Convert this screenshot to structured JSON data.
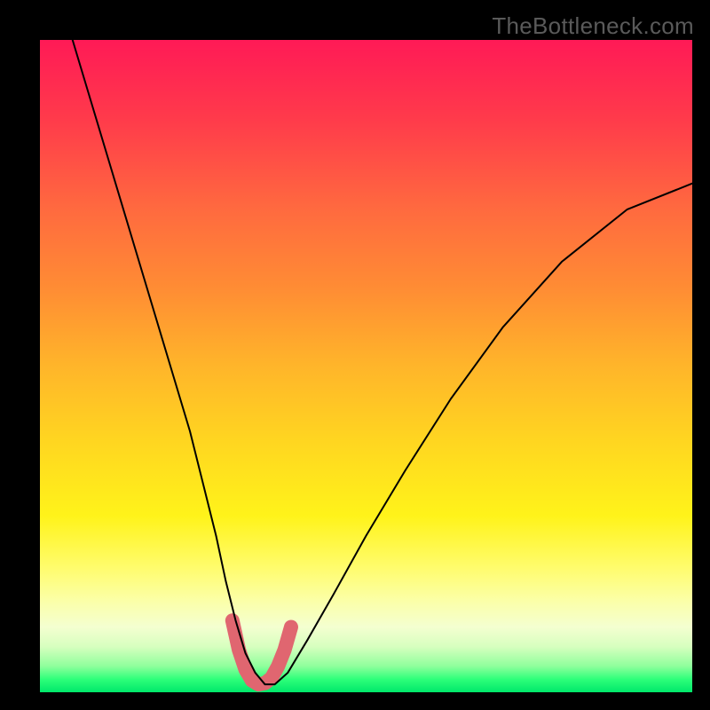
{
  "watermark": "TheBottleneck.com",
  "chart_data": {
    "type": "line",
    "title": "",
    "xlabel": "",
    "ylabel": "",
    "xlim": [
      0,
      100
    ],
    "ylim": [
      0,
      100
    ],
    "grid": false,
    "legend": false,
    "series": [
      {
        "name": "black-curve",
        "color": "#000000",
        "width": 2,
        "x": [
          5,
          8,
          11,
          14,
          17,
          20,
          23,
          25,
          27,
          28.5,
          30,
          31.5,
          33,
          34.5,
          36,
          38,
          41,
          45,
          50,
          56,
          63,
          71,
          80,
          90,
          100
        ],
        "y": [
          100,
          90,
          80,
          70,
          60,
          50,
          40,
          32,
          24,
          17,
          11,
          6,
          3,
          1.2,
          1.2,
          3,
          8,
          15,
          24,
          34,
          45,
          56,
          66,
          74,
          78
        ]
      },
      {
        "name": "pink-band",
        "color": "#e06670",
        "width": 16,
        "x": [
          29.5,
          30.5,
          31.5,
          32.5,
          33.5,
          34.5,
          35.5,
          36.5,
          37.5,
          38.5
        ],
        "y": [
          11,
          6.5,
          3.5,
          1.8,
          1.2,
          1.4,
          2.2,
          4.0,
          6.5,
          10
        ]
      }
    ],
    "background_gradient_vertical": {
      "top_color": "#ff1a56",
      "bottom_color": "#00e86a",
      "meaning": "value magnitude (red=high, green=low)"
    }
  }
}
